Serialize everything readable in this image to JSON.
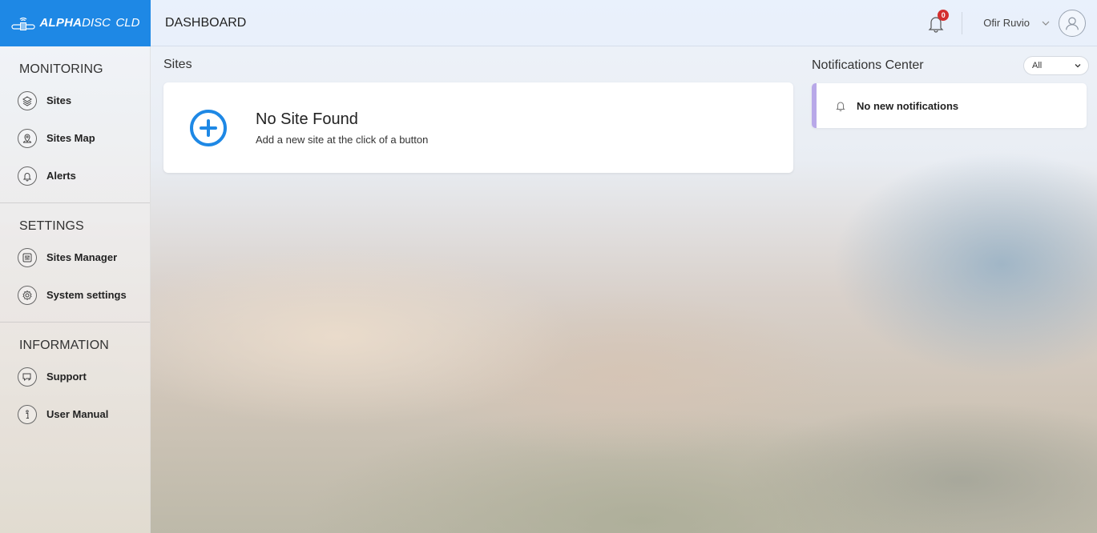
{
  "brand": {
    "name_bold": "ALPHA",
    "name_mid": "DISC",
    "name_light": "CLD"
  },
  "header": {
    "title": "DASHBOARD",
    "notification_count": "0",
    "user_name": "Ofir Ruvio"
  },
  "sidebar": {
    "sections": [
      {
        "title": "MONITORING",
        "items": [
          {
            "label": "Sites",
            "icon": "layers-icon"
          },
          {
            "label": "Sites Map",
            "icon": "map-pin-icon"
          },
          {
            "label": "Alerts",
            "icon": "bell-icon"
          }
        ]
      },
      {
        "title": "SETTINGS",
        "items": [
          {
            "label": "Sites Manager",
            "icon": "sliders-icon"
          },
          {
            "label": "System settings",
            "icon": "gear-icon"
          }
        ]
      },
      {
        "title": "INFORMATION",
        "items": [
          {
            "label": "Support",
            "icon": "chat-icon"
          },
          {
            "label": "User Manual",
            "icon": "info-icon"
          }
        ]
      }
    ]
  },
  "sites": {
    "heading": "Sites",
    "empty_title": "No Site Found",
    "empty_subtitle": "Add a new site at the click of a button"
  },
  "notifications": {
    "heading": "Notifications Center",
    "filter_value": "All",
    "empty_message": "No new notifications"
  },
  "colors": {
    "accent": "#1e88e5",
    "badge": "#d32f2f",
    "notif_border": "#b8a8e8"
  }
}
